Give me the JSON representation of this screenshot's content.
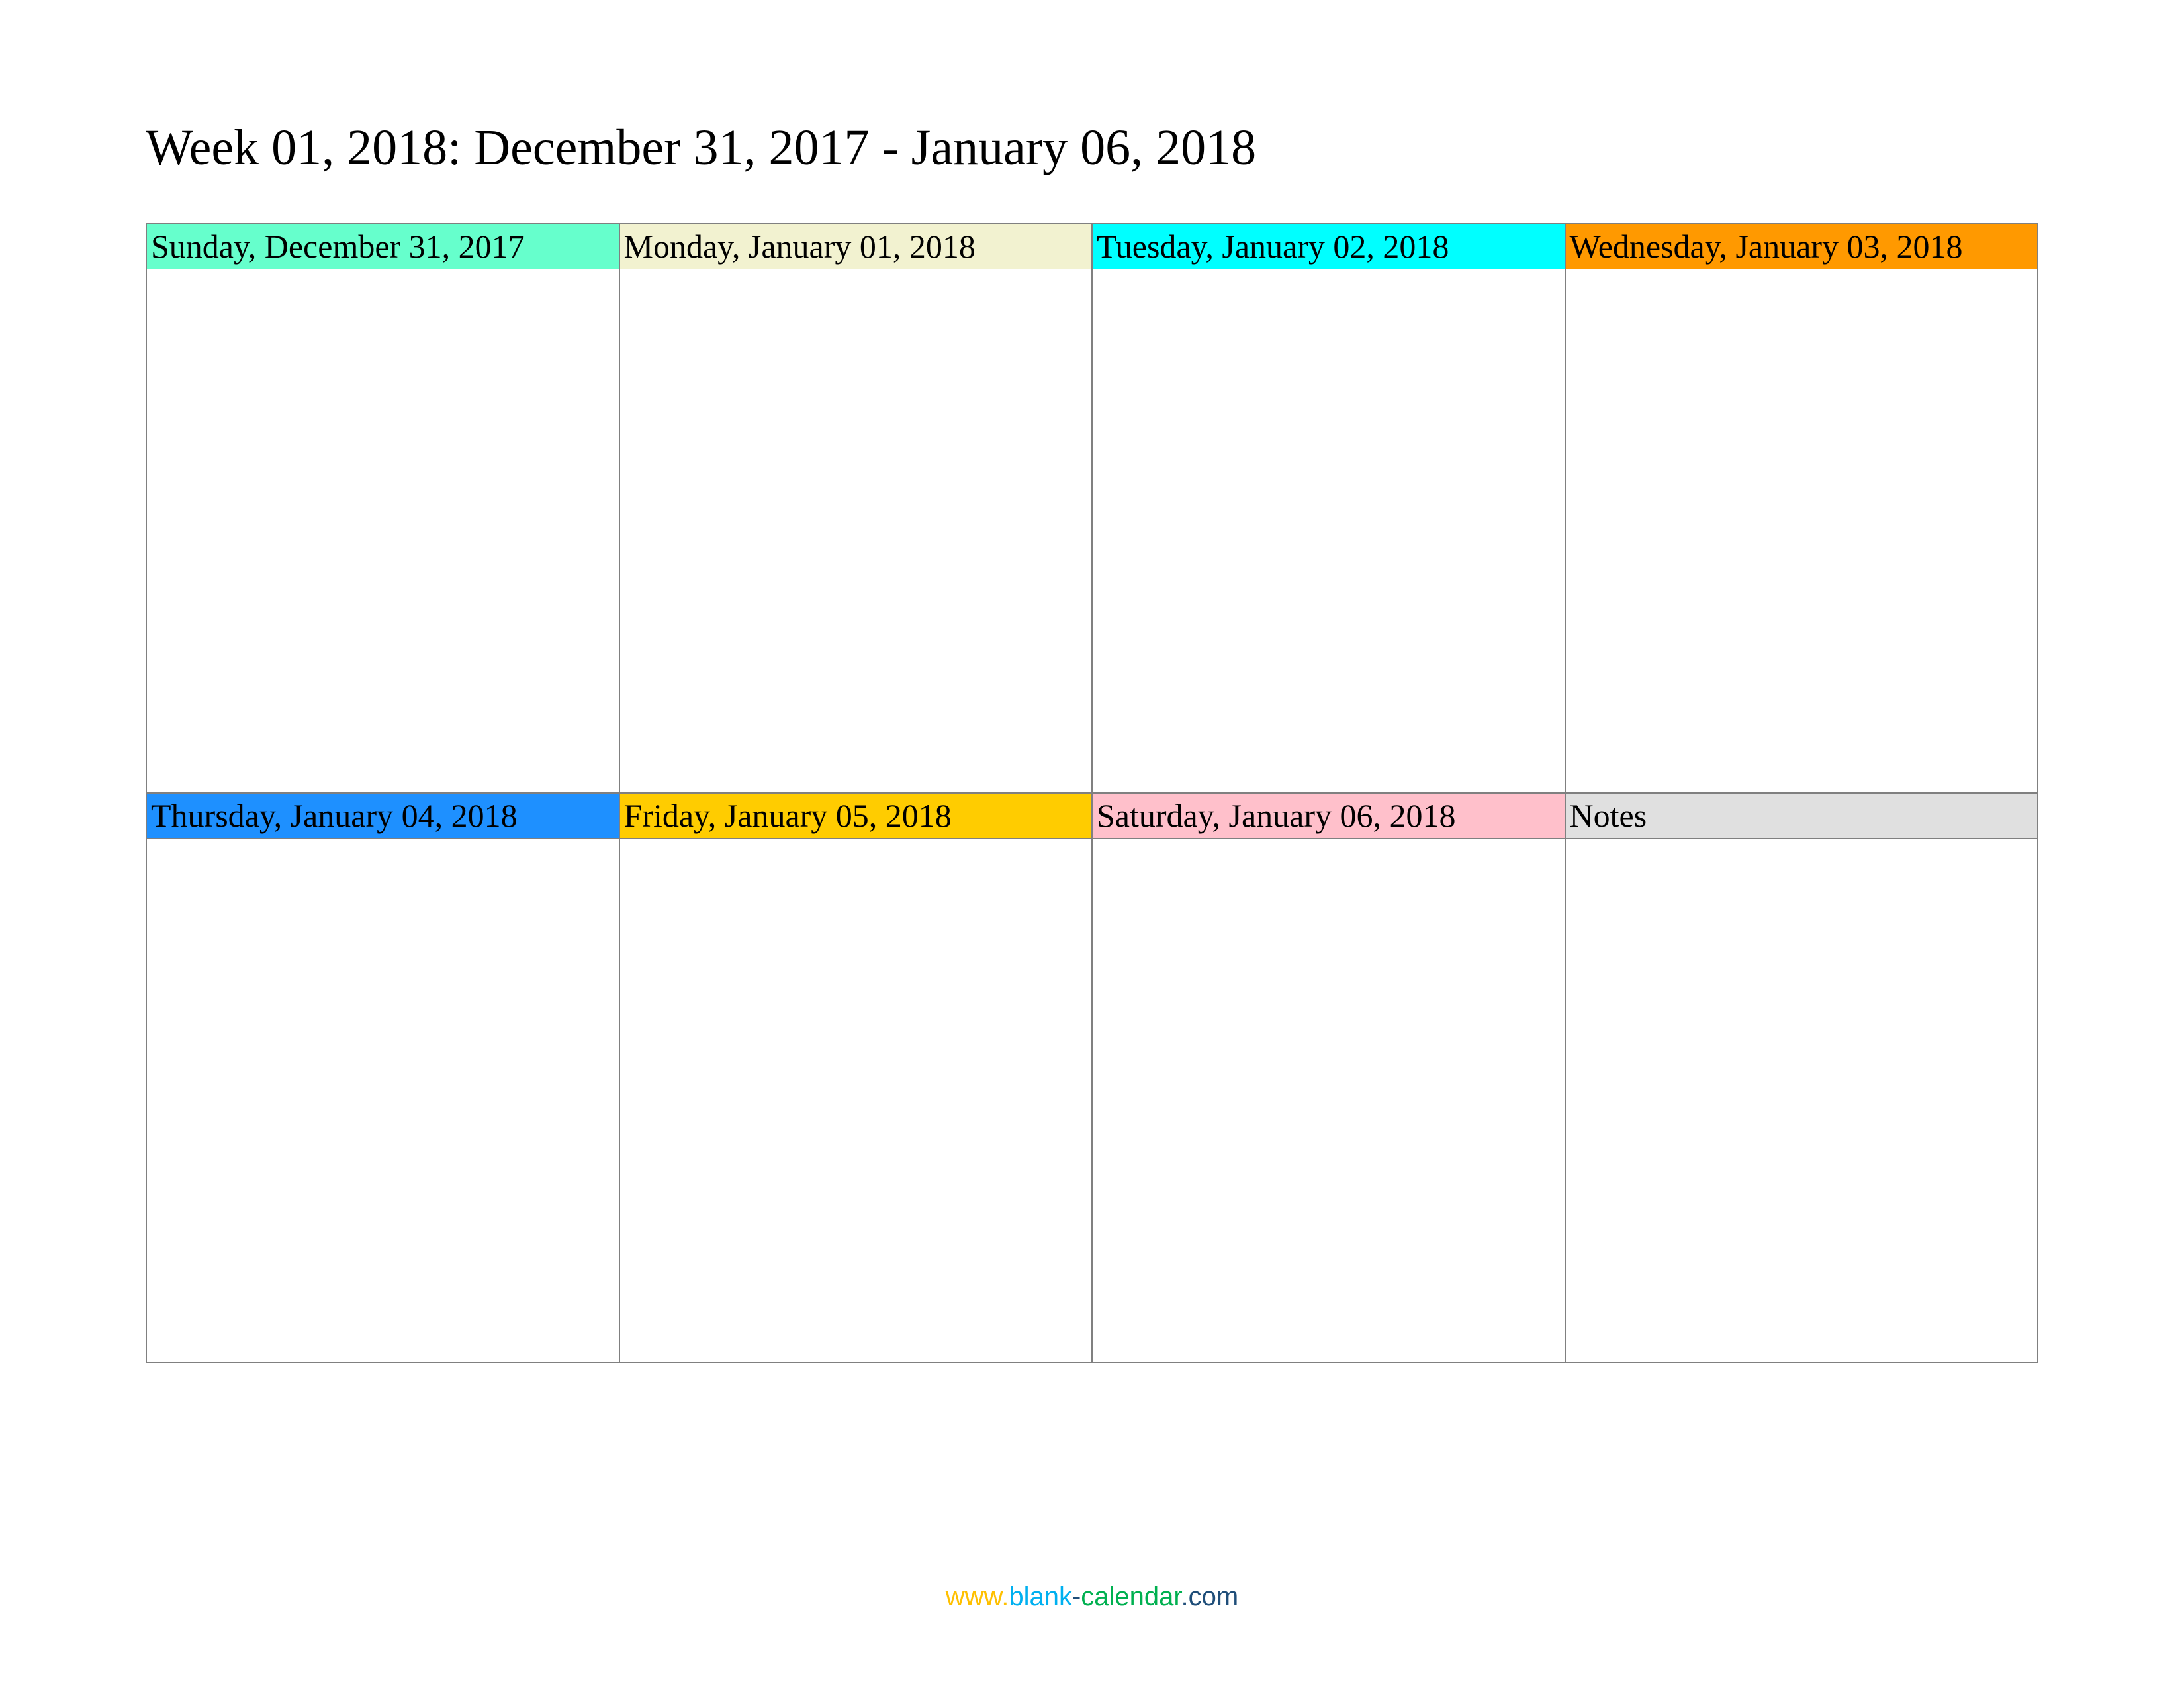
{
  "title": "Week 01, 2018: December 31, 2017 - January 06, 2018",
  "cells": [
    {
      "label": "Sunday, December 31, 2017",
      "bg": "#66ffcc"
    },
    {
      "label": "Monday, January 01, 2018",
      "bg": "#f2f2d0"
    },
    {
      "label": "Tuesday, January 02, 2018",
      "bg": "#00ffff"
    },
    {
      "label": "Wednesday, January 03, 2018",
      "bg": "#ff9900"
    },
    {
      "label": "Thursday, January 04, 2018",
      "bg": "#1e90ff"
    },
    {
      "label": "Friday, January 05, 2018",
      "bg": "#ffcc00"
    },
    {
      "label": "Saturday, January 06, 2018",
      "bg": "#ffc0cb"
    },
    {
      "label": "Notes",
      "bg": "#e0e0e0"
    }
  ],
  "footer": {
    "www": "www.",
    "blank": "blank",
    "dash": "-",
    "cal": "calendar",
    "com": ".com"
  }
}
